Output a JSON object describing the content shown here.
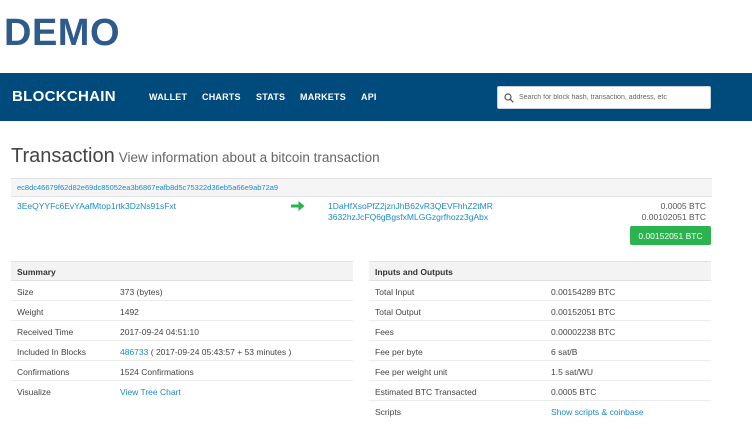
{
  "watermark": "DEMO",
  "navbar": {
    "brand": "BLOCKCHAIN",
    "items": [
      "WALLET",
      "CHARTS",
      "STATS",
      "MARKETS",
      "API"
    ],
    "search_placeholder": "Search for block hash, transaction, address, etc"
  },
  "page": {
    "title": "Transaction",
    "subtitle": "View information about a bitcoin transaction"
  },
  "transaction": {
    "hash": "ec8dc46679f62d82e69dc85052ea3b6867eafb8d5c75322d36eb5a66e9ab72a9",
    "input_address": "3EeQYYFc6EvYAafMtop1rtk3DzNs91sFxt",
    "outputs": [
      {
        "address": "1DaHfXsoPfZ2jznJhB62vR3QEVFhhZ2tMR",
        "amount": "0.0005 BTC"
      },
      {
        "address": "3632hzJcFQ6gBgsfxMLGGzgrfhozz3gAbx",
        "amount": "0.00102051 BTC"
      }
    ],
    "total": "0.00152051 BTC"
  },
  "summary": {
    "heading": "Summary",
    "rows": {
      "size": {
        "label": "Size",
        "value": "373 (bytes)"
      },
      "weight": {
        "label": "Weight",
        "value": "1492"
      },
      "received": {
        "label": "Received Time",
        "value": "2017-09-24 04:51:10"
      },
      "included": {
        "label": "Included In Blocks",
        "block": "486733",
        "value": "( 2017-09-24 05:43:57 + 53 minutes )"
      },
      "confirmations": {
        "label": "Confirmations",
        "value": "1524 Confirmations"
      },
      "visualize": {
        "label": "Visualize",
        "link": "View Tree Chart"
      }
    }
  },
  "io": {
    "heading": "Inputs and Outputs",
    "rows": {
      "total_input": {
        "label": "Total Input",
        "value": "0.00154289 BTC"
      },
      "total_output": {
        "label": "Total Output",
        "value": "0.00152051 BTC"
      },
      "fees": {
        "label": "Fees",
        "value": "0.00002238 BTC"
      },
      "fee_per_byte": {
        "label": "Fee per byte",
        "value": "6 sat/B"
      },
      "fee_per_wu": {
        "label": "Fee per weight unit",
        "value": "1.5 sat/WU"
      },
      "estimated": {
        "label": "Estimated BTC Transacted",
        "value": "0.0005 BTC"
      },
      "scripts": {
        "label": "Scripts",
        "link": "Show scripts & coinbase"
      }
    }
  },
  "colors": {
    "navbar": "#004a7c",
    "link": "#1a8ac9",
    "success": "#2bb34f",
    "watermark": "#2f5b8c"
  }
}
